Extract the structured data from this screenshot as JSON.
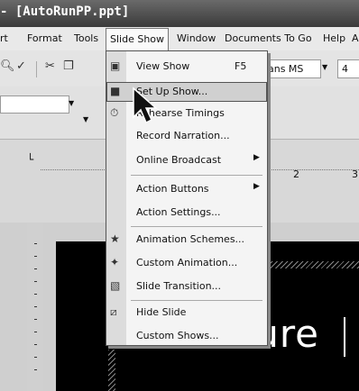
{
  "window": {
    "title": "- [AutoRunPP.ppt]"
  },
  "menubar": {
    "items": [
      {
        "label": "rt"
      },
      {
        "label": "Format"
      },
      {
        "label": "Tools"
      },
      {
        "label": "Slide Show"
      },
      {
        "label": "Window"
      },
      {
        "label": "Documents To Go"
      },
      {
        "label": "Help"
      },
      {
        "label": "A"
      }
    ]
  },
  "toolbar": {
    "font_name": "Sans MS",
    "font_size": "4"
  },
  "ruler": {
    "marks": [
      "2",
      "3"
    ]
  },
  "slide": {
    "text": "Procedure"
  },
  "dropdown": {
    "items": [
      {
        "label": "View Show",
        "shortcut": "F5",
        "icon": "projector-icon"
      },
      {
        "label": "Set Up Show...",
        "icon": "setup-show-icon"
      },
      {
        "label": "Rehearse Timings",
        "icon": "rehearse-timings-icon"
      },
      {
        "label": "Record Narration..."
      },
      {
        "label": "Online Broadcast",
        "submenu": "▶"
      },
      {
        "label": "Action Buttons",
        "submenu": "▶"
      },
      {
        "label": "Action Settings..."
      },
      {
        "label": "Animation Schemes...",
        "icon": "animation-schemes-icon"
      },
      {
        "label": "Custom Animation...",
        "icon": "custom-animation-icon"
      },
      {
        "label": "Slide Transition...",
        "icon": "slide-transition-icon"
      },
      {
        "label": "Hide Slide",
        "icon": "hide-slide-icon"
      },
      {
        "label": "Custom Shows..."
      }
    ]
  }
}
